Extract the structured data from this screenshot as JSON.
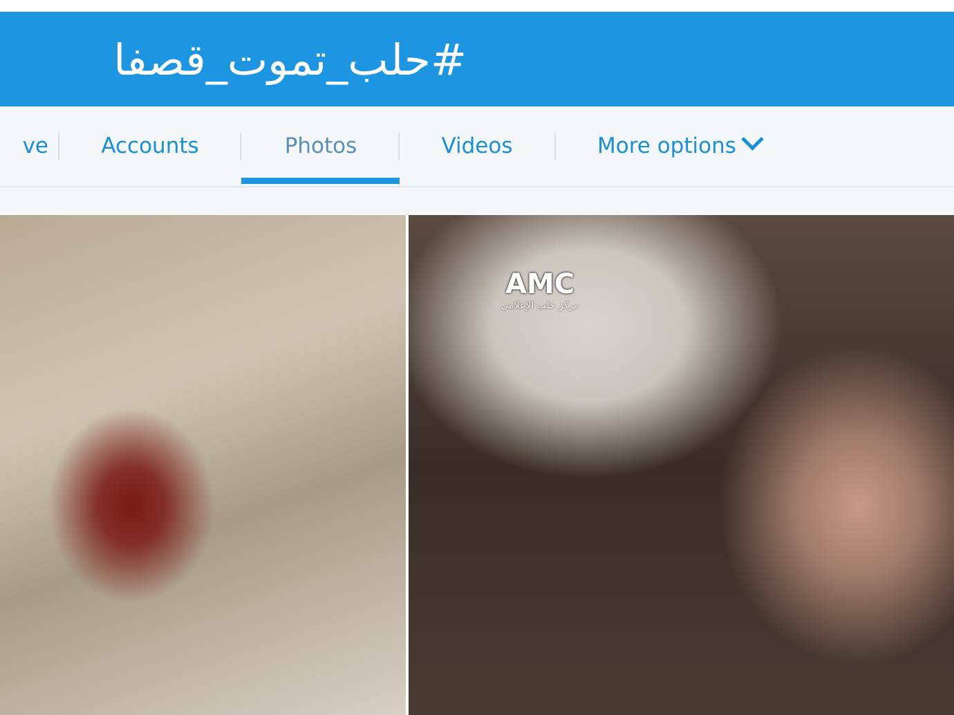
{
  "header": {
    "hashtag": "#حلب_تموت_قصفا"
  },
  "nav": {
    "tabs": [
      {
        "label": "ve"
      },
      {
        "label": "Accounts"
      },
      {
        "label": "Photos",
        "active": true
      },
      {
        "label": "Videos"
      },
      {
        "label": "More options"
      }
    ]
  },
  "photos": {
    "items": [
      {
        "watermark": ""
      },
      {
        "watermark": "AMC",
        "watermark_sub": "مركز حلب الإعلامي"
      }
    ]
  },
  "colors": {
    "header_bg": "#1d95e0",
    "tab_text": "#1b8fd6",
    "active_indicator": "#1d95e0",
    "nav_bg": "#f5f8fa"
  }
}
